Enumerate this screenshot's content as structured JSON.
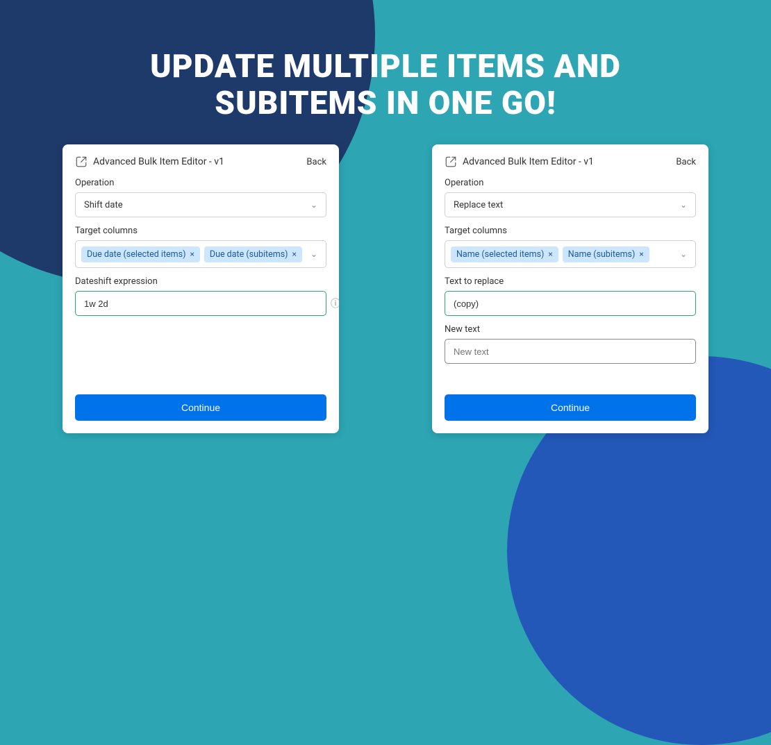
{
  "headline_line1": "UPDATE MULTIPLE ITEMS AND",
  "headline_line2": "SUBITEMS IN ONE GO!",
  "left": {
    "title": "Advanced Bulk Item Editor - v1",
    "back": "Back",
    "operation_label": "Operation",
    "operation_value": "Shift date",
    "target_label": "Target columns",
    "tags": [
      {
        "label": "Due date (selected items)"
      },
      {
        "label": "Due date (subitems)"
      }
    ],
    "expr_label": "Dateshift expression",
    "expr_value": "1w 2d",
    "continue": "Continue"
  },
  "right": {
    "title": "Advanced Bulk Item Editor - v1",
    "back": "Back",
    "operation_label": "Operation",
    "operation_value": "Replace text",
    "target_label": "Target columns",
    "tags": [
      {
        "label": "Name (selected items)"
      },
      {
        "label": "Name (subitems)"
      }
    ],
    "replace_label": "Text to replace",
    "replace_value": "(copy)",
    "newtext_label": "New text",
    "newtext_placeholder": "New text",
    "continue": "Continue"
  }
}
